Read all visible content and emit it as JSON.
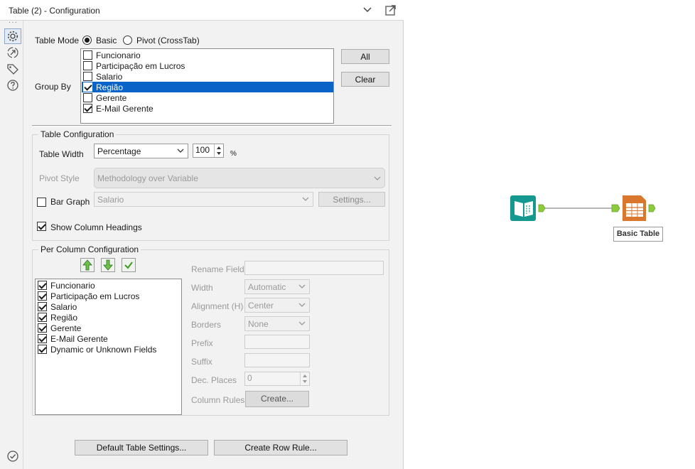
{
  "window": {
    "title": "Table (2) - Configuration"
  },
  "sidebar": {
    "dots": "···",
    "icons": [
      "gear-icon",
      "connection-icon",
      "tag-icon",
      "help-icon",
      "status-check-icon"
    ]
  },
  "table_mode": {
    "label": "Table Mode",
    "options": [
      {
        "label": "Basic",
        "selected": true
      },
      {
        "label": "Pivot (CrossTab)",
        "selected": false
      }
    ]
  },
  "group_by": {
    "label": "Group By",
    "items": [
      {
        "label": "Funcionario",
        "checked": false,
        "highlighted": false
      },
      {
        "label": "Participação em Lucros",
        "checked": false,
        "highlighted": false
      },
      {
        "label": "Salario",
        "checked": false,
        "highlighted": false
      },
      {
        "label": "Região",
        "checked": true,
        "highlighted": true
      },
      {
        "label": "Gerente",
        "checked": false,
        "highlighted": false
      },
      {
        "label": "E-Mail Gerente",
        "checked": true,
        "highlighted": false
      }
    ],
    "all_button": "All",
    "clear_button": "Clear"
  },
  "table_config": {
    "title": "Table Configuration",
    "table_width_label": "Table Width",
    "table_width_value": "Percentage",
    "table_width_number": "100",
    "percent_sign": "%",
    "pivot_style_label": "Pivot Style",
    "pivot_style_value": "Methodology over Variable",
    "bar_graph_label": "Bar Graph",
    "bar_graph_checked": false,
    "bar_graph_field": "Salario",
    "settings_button": "Settings...",
    "show_headings_label": "Show Column Headings",
    "show_headings_checked": true
  },
  "per_column": {
    "title": "Per Column Configuration",
    "fields": [
      {
        "label": "Funcionario",
        "checked": true
      },
      {
        "label": "Participação em Lucros",
        "checked": true
      },
      {
        "label": "Salario",
        "checked": true
      },
      {
        "label": "Região",
        "checked": true
      },
      {
        "label": "Gerente",
        "checked": true
      },
      {
        "label": "E-Mail Gerente",
        "checked": true
      },
      {
        "label": "Dynamic or Unknown Fields",
        "checked": true
      }
    ],
    "rename_field_label": "Rename Field",
    "width_label": "Width",
    "width_value": "Automatic",
    "alignment_label": "Alignment (H)",
    "alignment_value": "Center",
    "borders_label": "Borders",
    "borders_value": "None",
    "prefix_label": "Prefix",
    "suffix_label": "Suffix",
    "dec_places_label": "Dec. Places",
    "dec_places_value": "0",
    "column_rules_label": "Column Rules",
    "create_button": "Create..."
  },
  "footer": {
    "default_settings_button": "Default Table Settings...",
    "create_row_rule_button": "Create Row Rule..."
  },
  "canvas": {
    "tool_label": "Basic Table",
    "colors": {
      "input_tool": "#14988f",
      "table_tool": "#d9772f",
      "anchor": "#8ccc3c"
    }
  }
}
